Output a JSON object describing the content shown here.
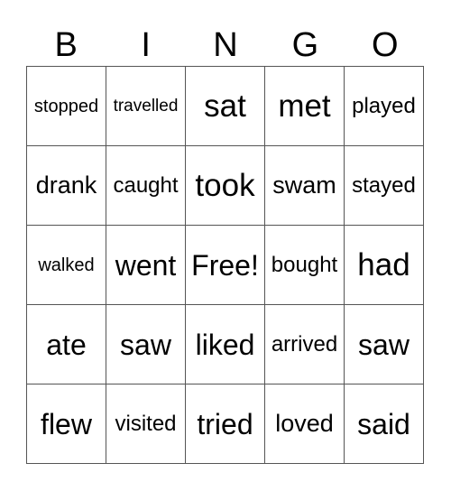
{
  "header": {
    "letters": [
      "B",
      "I",
      "N",
      "G",
      "O"
    ]
  },
  "card": {
    "rows": [
      [
        "stopped",
        "travelled",
        "sat",
        "met",
        "played"
      ],
      [
        "drank",
        "caught",
        "took",
        "swam",
        "stayed"
      ],
      [
        "walked",
        "went",
        "Free!",
        "bought",
        "had"
      ],
      [
        "ate",
        "saw",
        "liked",
        "arrived",
        "saw"
      ],
      [
        "flew",
        "visited",
        "tried",
        "loved",
        "said"
      ]
    ]
  }
}
